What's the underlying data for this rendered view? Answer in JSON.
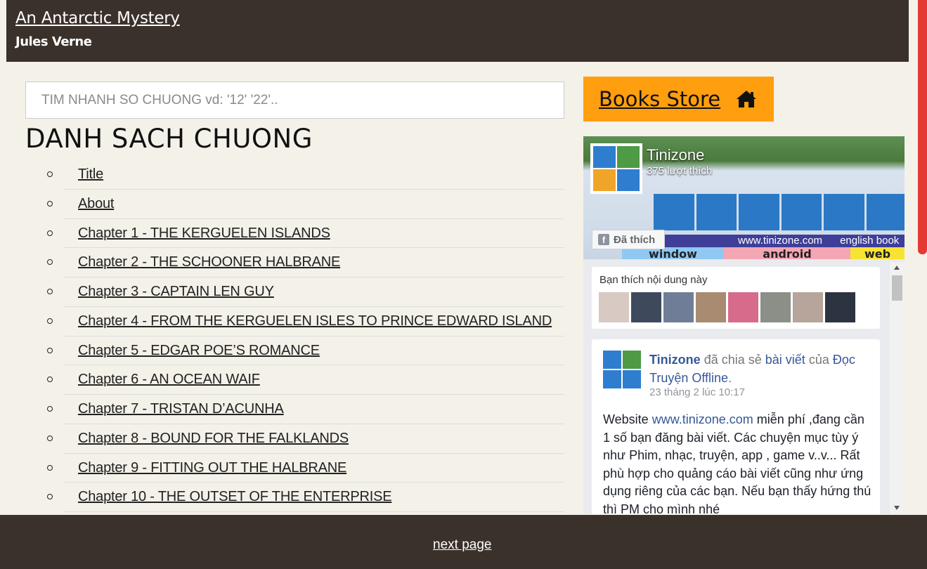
{
  "header": {
    "title": "An Antarctic Mystery",
    "author": "Jules Verne"
  },
  "search": {
    "placeholder": "TIM NHANH SO CHUONG vd: '12' '22'.."
  },
  "list": {
    "heading": "DANH SACH CHUONG",
    "chapters": [
      "Title",
      "About",
      "Chapter 1 - THE KERGUELEN ISLANDS",
      "Chapter 2 - THE SCHOONER HALBRANE",
      "Chapter 3 - CAPTAIN LEN GUY",
      "Chapter 4 - FROM THE KERGUELEN ISLES TO PRINCE EDWARD ISLAND",
      "Chapter 5 - EDGAR POE’S ROMANCE",
      "Chapter 6 - AN OCEAN WAIF",
      "Chapter 7 - TRISTAN D’ACUNHA",
      "Chapter 8 - BOUND FOR THE FALKLANDS",
      "Chapter 9 - FITTING OUT THE HALBRANE",
      "Chapter 10 - THE OUTSET OF THE ENTERPRISE"
    ]
  },
  "store": {
    "label": "Books Store",
    "icon": "home-icon"
  },
  "facebook": {
    "page_name": "Tinizone",
    "likes": "375 lượt thích",
    "liked_label": "Đã thích",
    "cover_site": "www.tinizone.com",
    "cover_english": "english book",
    "cover_tags": [
      "window",
      "android",
      "web"
    ],
    "friends_caption": "Bạn thích nội dung này",
    "post": {
      "page": "Tinizone",
      "shared": "đã chia sẻ",
      "post_link": "bài viết",
      "of": "của",
      "source": "Đọc Truyện Offline",
      "time": "23 tháng 2 lúc 10:17",
      "body_prefix": "Website",
      "body_url": "www.tinizone.com",
      "body_rest": "miễn phí ,đang cần 1 số bạn đăng bài viết. Các chuyện mục tùy ý như Phim, nhạc, truyện, app , game v..v... Rất phù hợp cho quảng cáo bài viết cũng như ứng dụng riêng của các bạn. Nếu bạn thấy hứng thú thì PM cho mình nhé"
    }
  },
  "footer": {
    "next": "next page"
  },
  "colors": {
    "header_bg": "#3b312b",
    "page_bg": "#f4f1e9",
    "store_bg": "#ff9e0f",
    "scroll_accent": "#e53935"
  }
}
